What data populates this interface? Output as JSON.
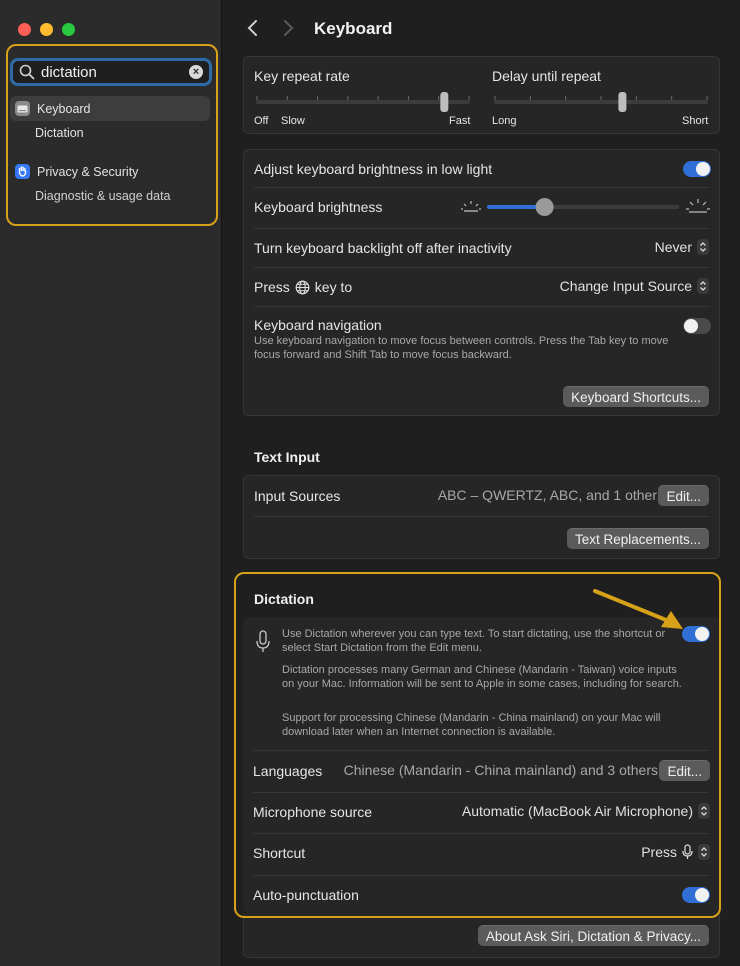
{
  "sidebar": {
    "search_value": "dictation",
    "items": [
      {
        "label": "Keyboard",
        "sub": "Dictation"
      },
      {
        "label": "Privacy & Security",
        "sub": "Diagnostic & usage data"
      }
    ]
  },
  "header": {
    "title": "Keyboard"
  },
  "repeat": {
    "key_repeat_label": "Key repeat rate",
    "key_repeat_left1": "Off",
    "key_repeat_left2": "Slow",
    "key_repeat_right": "Fast",
    "key_repeat_level": 0.88,
    "delay_label": "Delay until repeat",
    "delay_left": "Long",
    "delay_right": "Short",
    "delay_level": 0.6
  },
  "settings": {
    "adjust_brightness_label": "Adjust keyboard brightness in low light",
    "brightness_label": "Keyboard brightness",
    "brightness_level": 0.3,
    "backlight_off_label": "Turn keyboard backlight off after inactivity",
    "backlight_off_value": "Never",
    "press_key_label_pre": "Press",
    "press_key_label_post": "key to",
    "press_key_value": "Change Input Source",
    "keyboard_nav_label": "Keyboard navigation",
    "keyboard_nav_desc": "Use keyboard navigation to move focus between controls. Press the Tab key to move focus forward and Shift Tab to move focus backward.",
    "shortcuts_button": "Keyboard Shortcuts..."
  },
  "text_input": {
    "title": "Text Input",
    "sources_label": "Input Sources",
    "sources_value": "ABC – QWERTZ, ABC, and 1 other",
    "edit_button": "Edit...",
    "replacements_button": "Text Replacements..."
  },
  "dictation": {
    "title": "Dictation",
    "desc1": "Use Dictation wherever you can type text. To start dictating, use the shortcut or select Start Dictation from the Edit menu.",
    "desc2": "Dictation processes many German and Chinese (Mandarin - Taiwan) voice inputs on your Mac. Information will be sent to Apple in some cases, including for search.",
    "desc3": "Support for processing Chinese (Mandarin - China mainland) on your Mac will download later when an Internet connection is available.",
    "languages_label": "Languages",
    "languages_value": "Chinese (Mandarin - China mainland) and 3 others",
    "languages_edit": "Edit...",
    "mic_label": "Microphone source",
    "mic_value": "Automatic (MacBook Air Microphone)",
    "shortcut_label": "Shortcut",
    "shortcut_value": "Press",
    "autopunct_label": "Auto-punctuation",
    "about_button": "About Ask Siri, Dictation & Privacy..."
  },
  "colors": {
    "accent": "#2f6fd6",
    "highlight": "#d7a21a"
  }
}
